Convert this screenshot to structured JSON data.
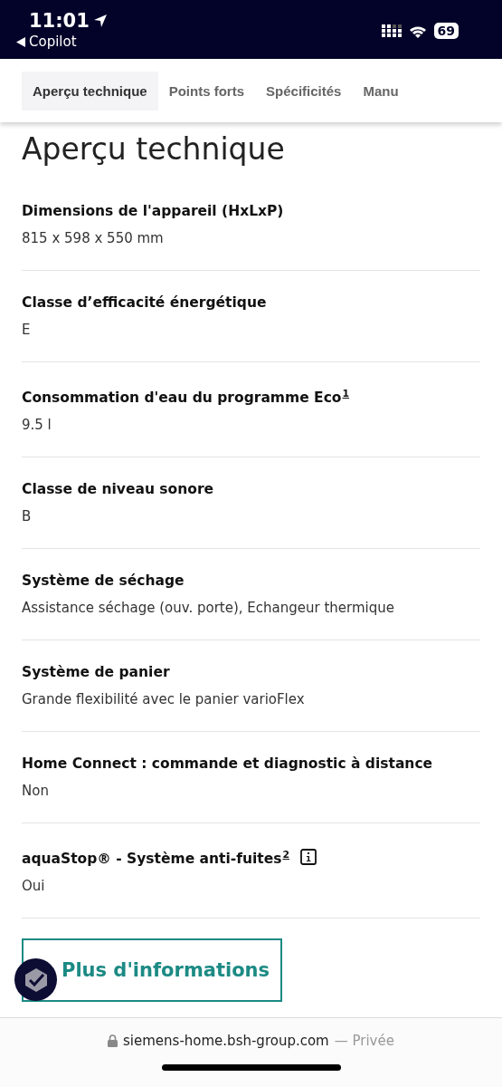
{
  "status_bar": {
    "time": "11:01",
    "back_label": "Copilot",
    "battery": "69"
  },
  "tabs": [
    {
      "label": "Aperçu technique",
      "selected": true
    },
    {
      "label": "Points forts",
      "selected": false
    },
    {
      "label": "Spécificités",
      "selected": false
    },
    {
      "label": "Manu",
      "selected": false
    }
  ],
  "heading": "Aperçu technique",
  "specs": [
    {
      "label": "Dimensions de l'appareil (HxLxP)",
      "value": "815 x 598 x 550 mm",
      "info": false
    },
    {
      "label": "Classe d’efficacité énergétique",
      "value": "E",
      "info": false
    },
    {
      "label": "Consommation d'eau du programme Eco$^{1}$",
      "value": "9.5 l",
      "info": false
    },
    {
      "label": "Classe de niveau sonore",
      "value": "B",
      "info": false
    },
    {
      "label": "Système de séchage",
      "value": "Assistance séchage (ouv. porte), Echangeur thermique",
      "info": false
    },
    {
      "label": "Système de panier",
      "value": "Grande flexibilité avec le panier varioFlex",
      "info": false
    },
    {
      "label": "Home Connect : commande et diagnostic à distance",
      "value": "Non",
      "info": false
    },
    {
      "label": "aquaStop® - Système anti-fuites$^{2}$",
      "value": "Oui",
      "info": true
    }
  ],
  "more_button": "Plus d'informations",
  "address_bar": {
    "domain": "siemens-home.bsh-group.com",
    "mode": "— Privée"
  }
}
